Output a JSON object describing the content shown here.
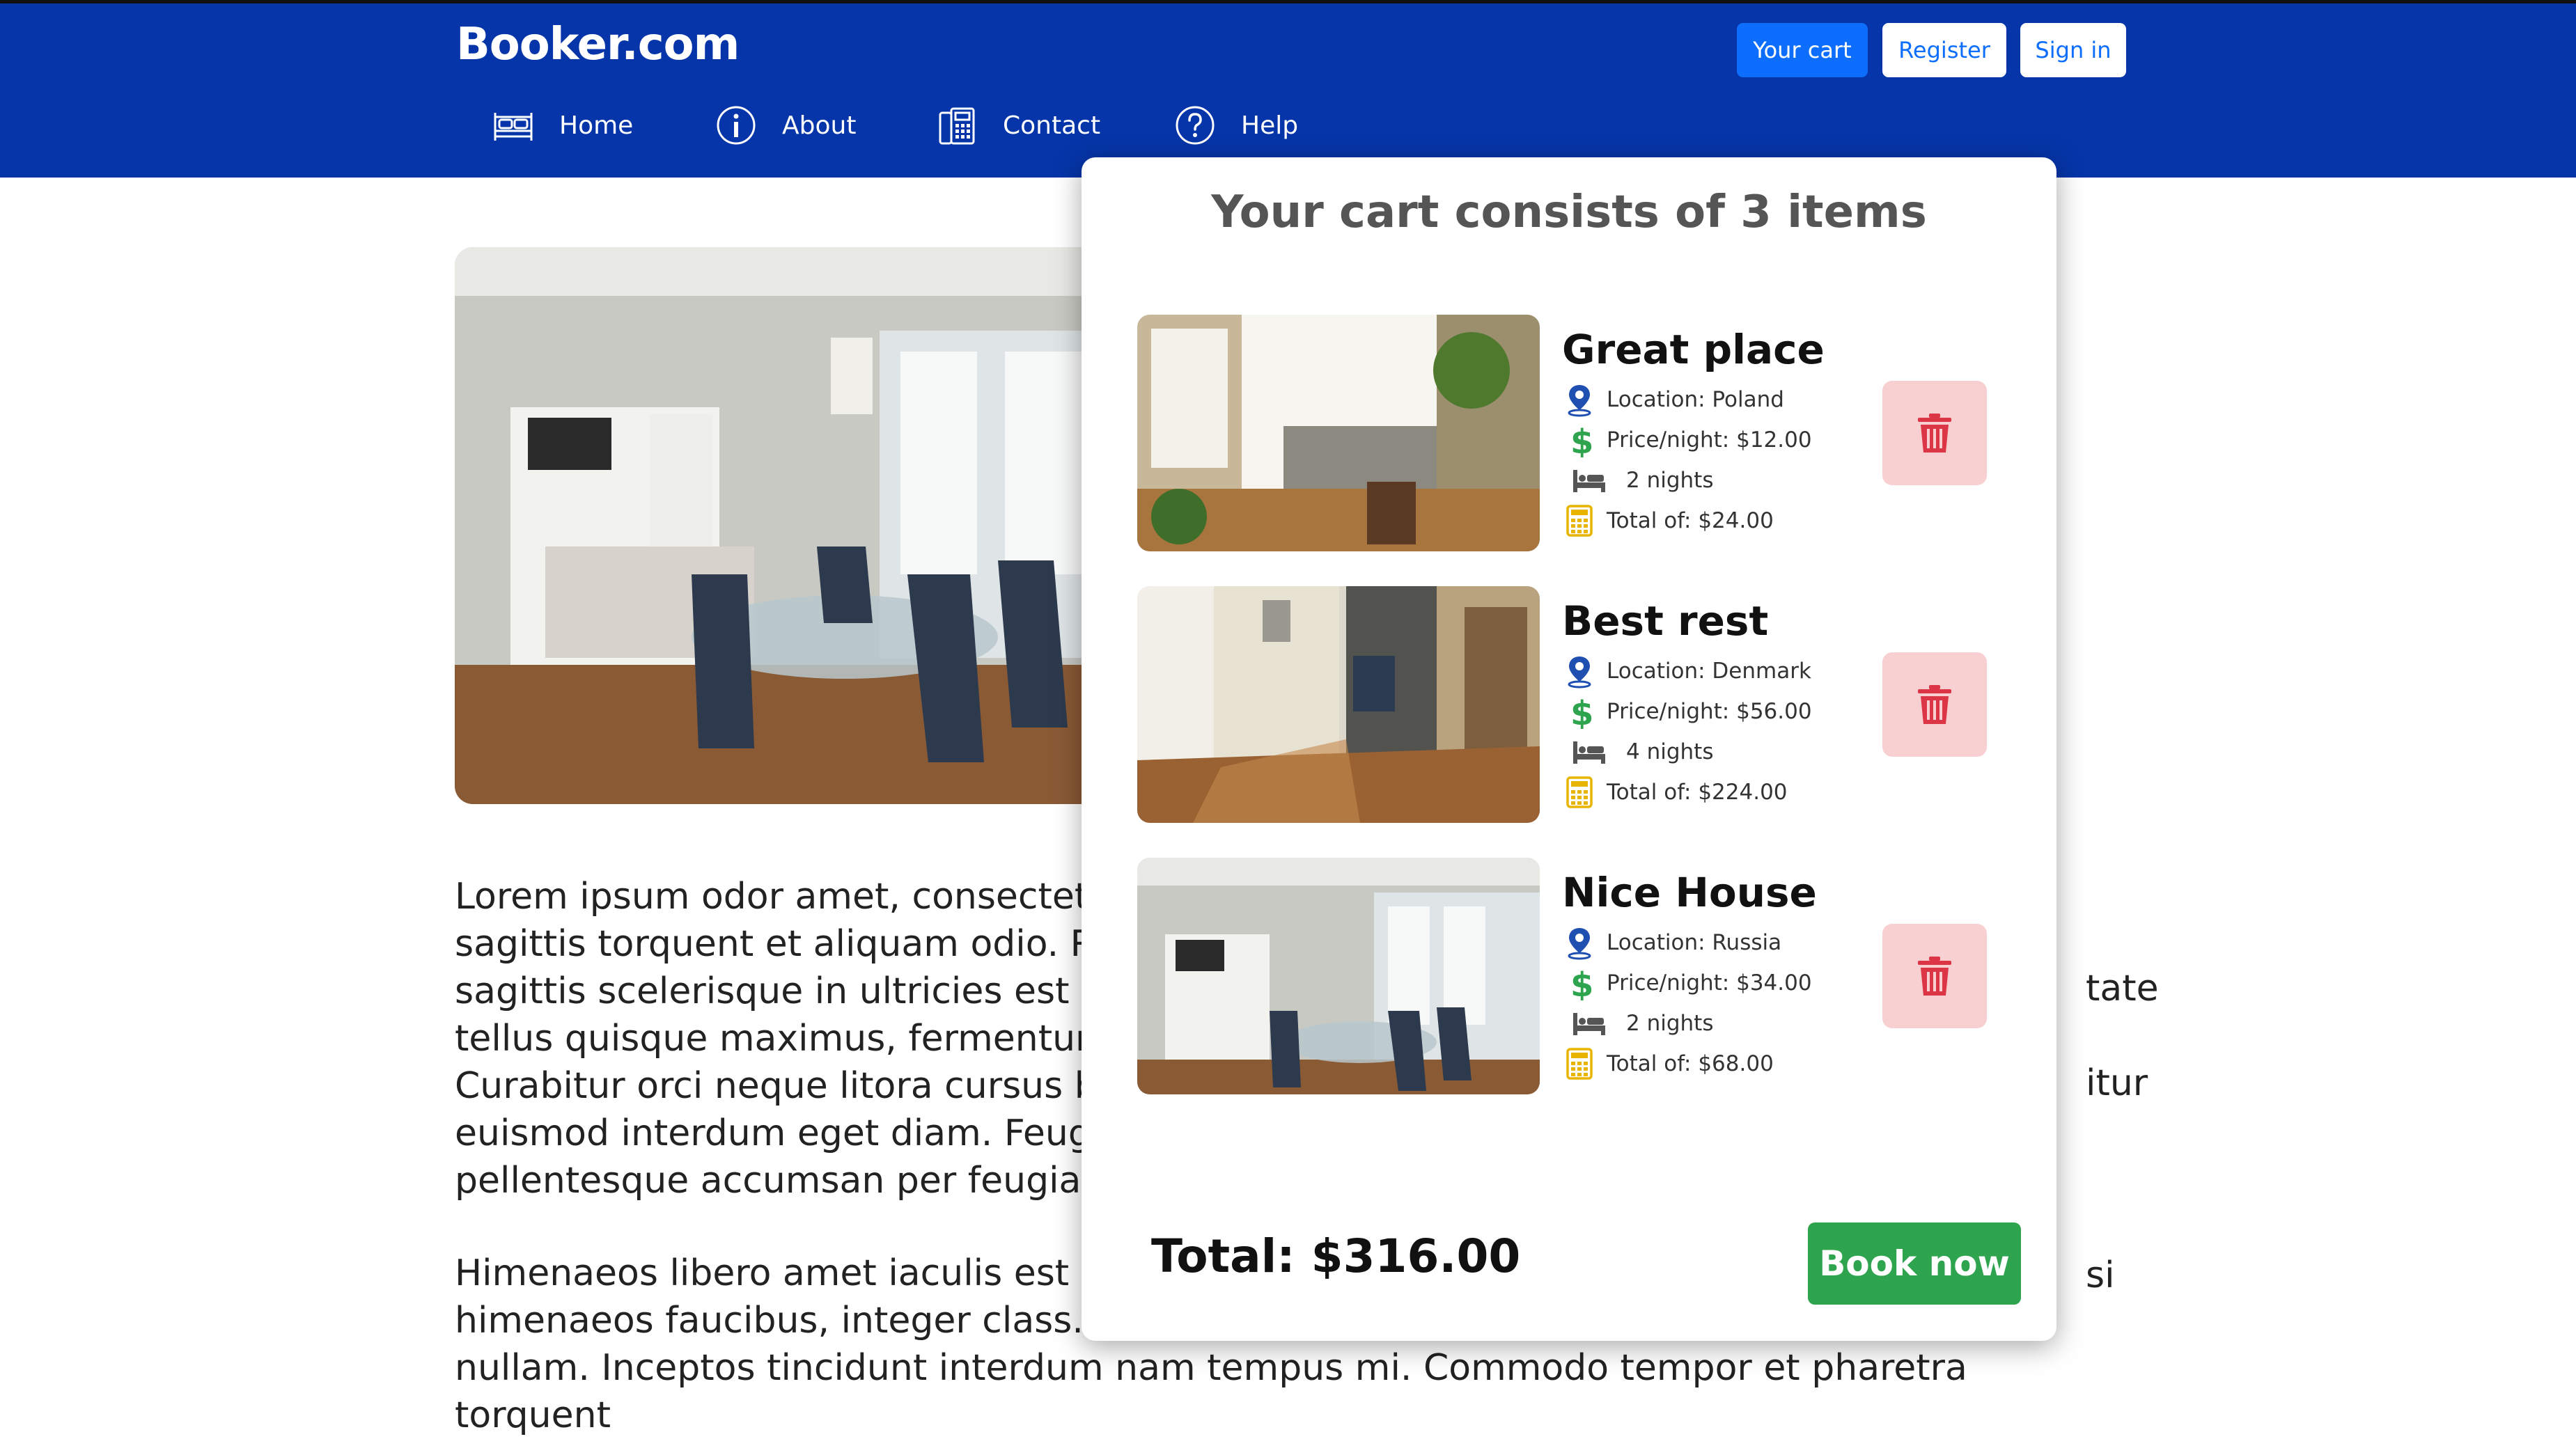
{
  "header": {
    "brand": "Booker.com",
    "buttons": {
      "cart": "Your cart",
      "register": "Register",
      "signin": "Sign in"
    },
    "nav": [
      {
        "label": "Home",
        "icon": "bed-icon"
      },
      {
        "label": "About",
        "icon": "info-icon"
      },
      {
        "label": "Contact",
        "icon": "phone-icon"
      },
      {
        "label": "Help",
        "icon": "question-icon"
      }
    ]
  },
  "main": {
    "paragraph1": "Lorem ipsum odor amet, consectetu\nsagittis torquent et aliquam odio. Ri\nsagittis scelerisque in ultricies est po\ntellus quisque maximus, fermentum\nCurabitur orci neque litora cursus bi\neuismod interdum eget diam. Feugi\npellentesque accumsan per feugiat",
    "paragraph2": "Himenaeos libero amet iaculis est vi\nhimenaeos faucibus, integer class. L\nnullam. Inceptos tincidunt interdum nam tempus mi. Commodo tempor et pharetra torquent",
    "fragment_right_1": "tate",
    "fragment_right_2": "itur",
    "fragment_right_3": "si"
  },
  "cart": {
    "title": "Your cart consists of 3 items",
    "items": [
      {
        "name": "Great place",
        "location": "Location: Poland",
        "price": "Price/night: $12.00",
        "nights": "2 nights",
        "total": "Total of: $24.00"
      },
      {
        "name": "Best rest",
        "location": "Location: Denmark",
        "price": "Price/night: $56.00",
        "nights": "4 nights",
        "total": "Total of: $224.00"
      },
      {
        "name": "Nice House",
        "location": "Location: Russia",
        "price": "Price/night: $34.00",
        "nights": "2 nights",
        "total": "Total of: $68.00"
      }
    ],
    "total": "Total: $316.00",
    "book_label": "Book now"
  },
  "colors": {
    "header_bg": "#0535a8",
    "primary": "#0d6efd",
    "success": "#2ea44f",
    "danger": "#dc3545",
    "danger_light": "#f8d0d2"
  }
}
